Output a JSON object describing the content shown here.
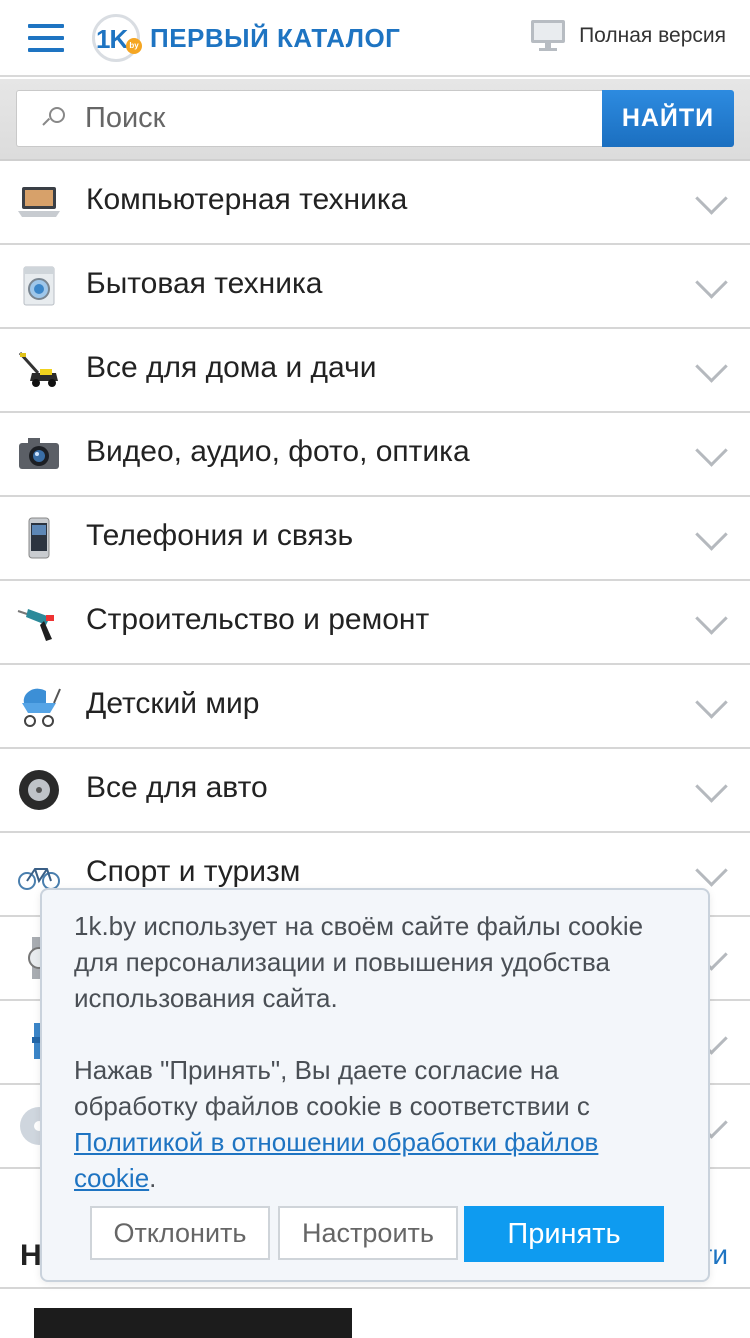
{
  "header": {
    "logo_text": "ПЕРВЫЙ КАТАЛОГ",
    "logo_badge": "1K",
    "logo_by": "by",
    "full_version_label": "Полная версия"
  },
  "search": {
    "placeholder": "Поиск",
    "button_label": "НАЙТИ"
  },
  "categories": [
    {
      "label": "Компьютерная техника",
      "icon": "laptop-icon"
    },
    {
      "label": "Бытовая техника",
      "icon": "washing-machine-icon"
    },
    {
      "label": "Все для дома и дачи",
      "icon": "lawn-mower-icon"
    },
    {
      "label": "Видео, аудио, фото, оптика",
      "icon": "camera-icon"
    },
    {
      "label": "Телефония и связь",
      "icon": "phone-icon"
    },
    {
      "label": "Строительство и ремонт",
      "icon": "drill-icon"
    },
    {
      "label": "Детский мир",
      "icon": "stroller-icon"
    },
    {
      "label": "Все для авто",
      "icon": "tire-icon"
    },
    {
      "label": "Спорт и туризм",
      "icon": "bicycle-icon"
    },
    {
      "label": "",
      "icon": "watch-icon"
    },
    {
      "label": "",
      "icon": "beauty-icon"
    },
    {
      "label": "",
      "icon": "disc-icon"
    }
  ],
  "news": {
    "title": "Н",
    "all_link": "ти"
  },
  "cookie": {
    "text1": "1k.by использует на своём сайте файлы cookie для персонализации и повышения удобства использования сайта.",
    "text2_prefix": "Нажав \"Принять\", Вы даете согласие на обработку файлов cookie в соответствии с ",
    "policy_link": "Политикой в отношении обработки файлов cookie",
    "text2_suffix": ".",
    "decline_label": "Отклонить",
    "settings_label": "Настроить",
    "accept_label": "Принять"
  }
}
